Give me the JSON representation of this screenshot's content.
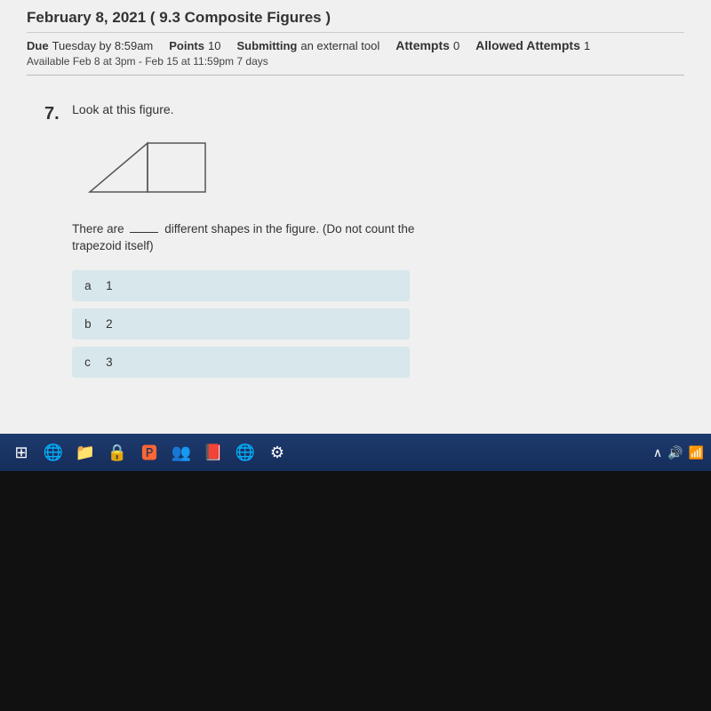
{
  "page": {
    "title": "February 8, 2021 ( 9.3 Composite Figures )",
    "due_label": "Due",
    "due_value": "Tuesday by 8:59am",
    "points_label": "Points",
    "points_value": "10",
    "submitting_label": "Submitting",
    "submitting_value": "an external tool",
    "attempts_label": "Attempts",
    "attempts_value": "0",
    "allowed_attempts_label": "Allowed Attempts",
    "allowed_attempts_value": "1",
    "available_label": "Available",
    "available_value": "Feb 8 at 3pm - Feb 15 at 11:59pm",
    "available_days": "7 days"
  },
  "question": {
    "number": "7.",
    "prompt": "Look at this figure.",
    "text_before": "There are",
    "blank": "___",
    "text_after": "different shapes in the figure. (Do not count the",
    "text_line2": "trapezoid itself)",
    "choices": [
      {
        "letter": "a",
        "value": "1"
      },
      {
        "letter": "b",
        "value": "2"
      },
      {
        "letter": "c",
        "value": "3"
      }
    ]
  },
  "taskbar": {
    "icons": [
      "⊞",
      "🌐",
      "📁",
      "🔒",
      "🅿",
      "👥",
      "📕",
      "🌐",
      "⚙"
    ]
  }
}
